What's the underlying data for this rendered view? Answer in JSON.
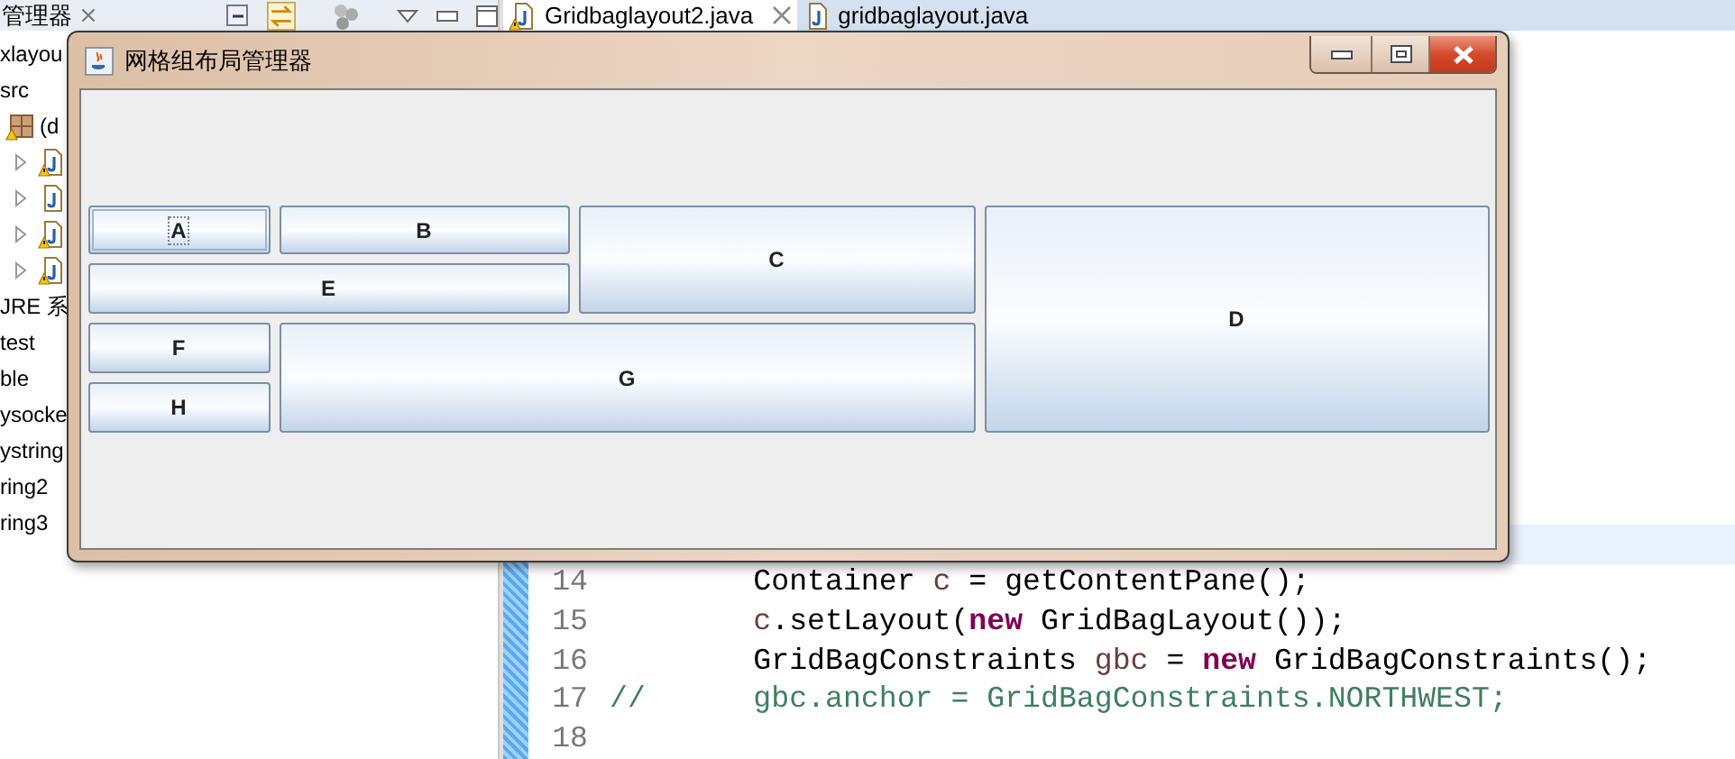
{
  "explorer": {
    "tab": {
      "label": "管理器"
    },
    "items": [
      {
        "kind": "text",
        "label": "xlayou"
      },
      {
        "kind": "text",
        "label": "src"
      },
      {
        "kind": "package",
        "label": "(d"
      },
      {
        "kind": "file",
        "warning": true
      },
      {
        "kind": "file",
        "warning": false
      },
      {
        "kind": "file",
        "warning": true
      },
      {
        "kind": "file",
        "warning": true
      },
      {
        "kind": "text",
        "label": "JRE 系"
      },
      {
        "kind": "text",
        "label": "test"
      },
      {
        "kind": "text",
        "label": "ble"
      },
      {
        "kind": "text",
        "label": "ysocke"
      },
      {
        "kind": "text",
        "label": "ystring"
      },
      {
        "kind": "text",
        "label": "ring2"
      },
      {
        "kind": "text",
        "label": "ring3"
      }
    ]
  },
  "editor": {
    "tabs": [
      {
        "label": "Gridbaglayout2.java",
        "selected": true,
        "warning": true
      },
      {
        "label": "gridbaglayout.java",
        "selected": false,
        "warning": false
      }
    ],
    "lines": [
      {
        "number": "14",
        "indented": true,
        "tokens": [
          {
            "kind": "plain",
            "text": "Container "
          },
          {
            "kind": "field",
            "text": "c"
          },
          {
            "kind": "plain",
            "text": " = getContentPane();"
          }
        ]
      },
      {
        "number": "15",
        "indented": true,
        "tokens": [
          {
            "kind": "field",
            "text": "c"
          },
          {
            "kind": "plain",
            "text": ".setLayout("
          },
          {
            "kind": "keyword",
            "text": "new"
          },
          {
            "kind": "plain",
            "text": " GridBagLayout());"
          }
        ]
      },
      {
        "number": "16",
        "indented": true,
        "tokens": [
          {
            "kind": "plain",
            "text": "GridBagConstraints "
          },
          {
            "kind": "field",
            "text": "gbc"
          },
          {
            "kind": "plain",
            "text": " = "
          },
          {
            "kind": "keyword",
            "text": "new"
          },
          {
            "kind": "plain",
            "text": " GridBagConstraints();"
          }
        ]
      },
      {
        "number": "17",
        "indented": false,
        "tokens": [
          {
            "kind": "comment",
            "text": "//      gbc.anchor = GridBagConstraints.NORTHWEST;"
          }
        ]
      },
      {
        "number": "18"
      }
    ]
  },
  "window": {
    "title": "网格组布局管理器",
    "buttons": [
      {
        "label": "A",
        "focused": true
      },
      {
        "label": "B",
        "focused": false
      },
      {
        "label": "C",
        "focused": false
      },
      {
        "label": "D",
        "focused": false
      },
      {
        "label": "E",
        "focused": false
      },
      {
        "label": "F",
        "focused": false
      },
      {
        "label": "G",
        "focused": false
      },
      {
        "label": "H",
        "focused": false
      }
    ]
  }
}
